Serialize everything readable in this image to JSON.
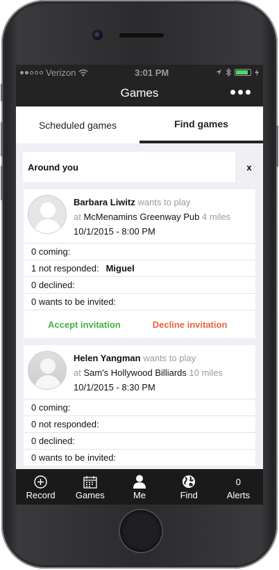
{
  "status_bar": {
    "carrier": "Verizon",
    "time": "3:01 PM",
    "battery_level": 0.85,
    "battery_color": "#4cd964"
  },
  "header": {
    "title": "Games",
    "more_icon": "more-icon"
  },
  "tabs": [
    {
      "label": "Scheduled games",
      "active": false
    },
    {
      "label": "Find games",
      "active": true
    }
  ],
  "filter": {
    "label": "Around you",
    "close_label": "x"
  },
  "invitations": [
    {
      "host": "Barbara Liwitz",
      "wants_text": "wants to play",
      "at_text": "at",
      "venue": "McMenamins Greenway Pub",
      "distance": "4 miles",
      "datetime": "10/1/2015 - 8:00 PM",
      "coming": "0 coming:",
      "not_responded": "1 not responded:",
      "not_responded_names": "Miguel",
      "declined": "0 declined:",
      "wants_invited": "0 wants to be invited:",
      "accept_label": "Accept invitation",
      "decline_label": "Decline invitation"
    },
    {
      "host": "Helen Yangman",
      "wants_text": "wants to play",
      "at_text": "at",
      "venue": "Sam's Hollywood Billiards",
      "distance": "10 miles",
      "datetime": "10/1/2015 - 8:30 PM",
      "coming": "0 coming:",
      "not_responded": "0 not responded:",
      "declined": "0 declined:",
      "wants_invited": "0 wants to be invited:"
    }
  ],
  "tab_bar": [
    {
      "label": "Record",
      "icon": "plus-circle-icon"
    },
    {
      "label": "Games",
      "icon": "calendar-icon"
    },
    {
      "label": "Me",
      "icon": "person-icon"
    },
    {
      "label": "Find",
      "icon": "globe-icon"
    },
    {
      "label": "Alerts",
      "badge": "0"
    }
  ],
  "colors": {
    "accept": "#44b244",
    "decline": "#e8663f",
    "bar": "#232323"
  }
}
